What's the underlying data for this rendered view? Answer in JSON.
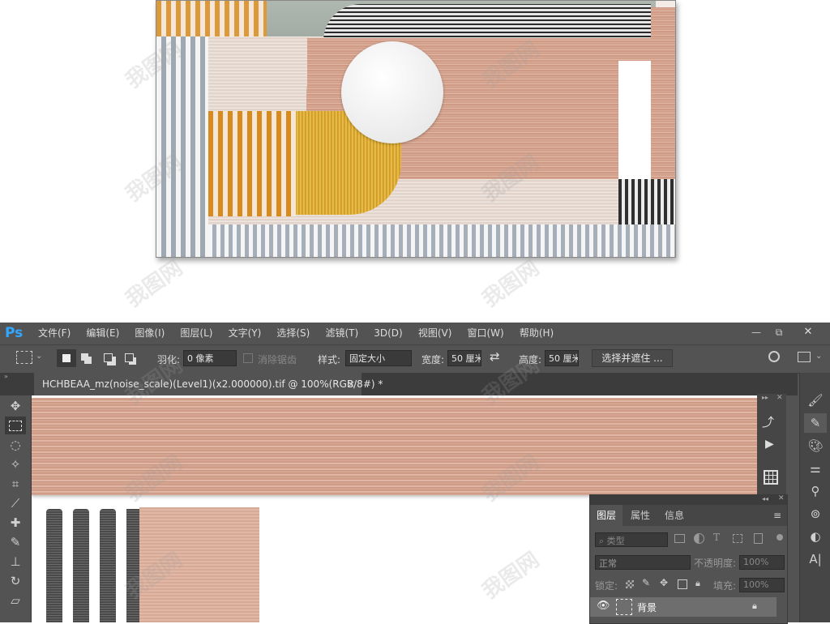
{
  "app": {
    "logo": "Ps"
  },
  "menu": {
    "items": [
      "文件(F)",
      "编辑(E)",
      "图像(I)",
      "图层(L)",
      "文字(Y)",
      "选择(S)",
      "滤镜(T)",
      "3D(D)",
      "视图(V)",
      "窗口(W)",
      "帮助(H)"
    ]
  },
  "window_controls": {
    "minimize": "—",
    "restore": "⧉",
    "close": "✕"
  },
  "options_bar": {
    "feather_label": "羽化:",
    "feather_value": "0 像素",
    "antialias_label": "消除锯齿",
    "style_label": "样式:",
    "style_value": "固定大小",
    "width_label": "宽度:",
    "width_value": "50 厘米",
    "swap_icon": "⇄",
    "height_label": "高度:",
    "height_value": "50 厘米",
    "select_mask_button": "选择并遮住 ..."
  },
  "document_tab": {
    "title": "HCHBEAA_mz(noise_scale)(Level1)(x2.000000).tif @ 100%(RGB/8#) *",
    "close": "×"
  },
  "layers_panel": {
    "tabs": [
      "图层",
      "属性",
      "信息"
    ],
    "filter_placeholder": "类型",
    "blend_mode": "正常",
    "opacity_label": "不透明度:",
    "opacity_value": "100%",
    "lock_label": "锁定:",
    "fill_label": "填充:",
    "fill_value": "100%",
    "layer_name": "背景"
  },
  "watermark": "我图网",
  "colors": {
    "ui_dark": "#535353",
    "ui_darker": "#3c3c3c",
    "panel": "#464646"
  }
}
